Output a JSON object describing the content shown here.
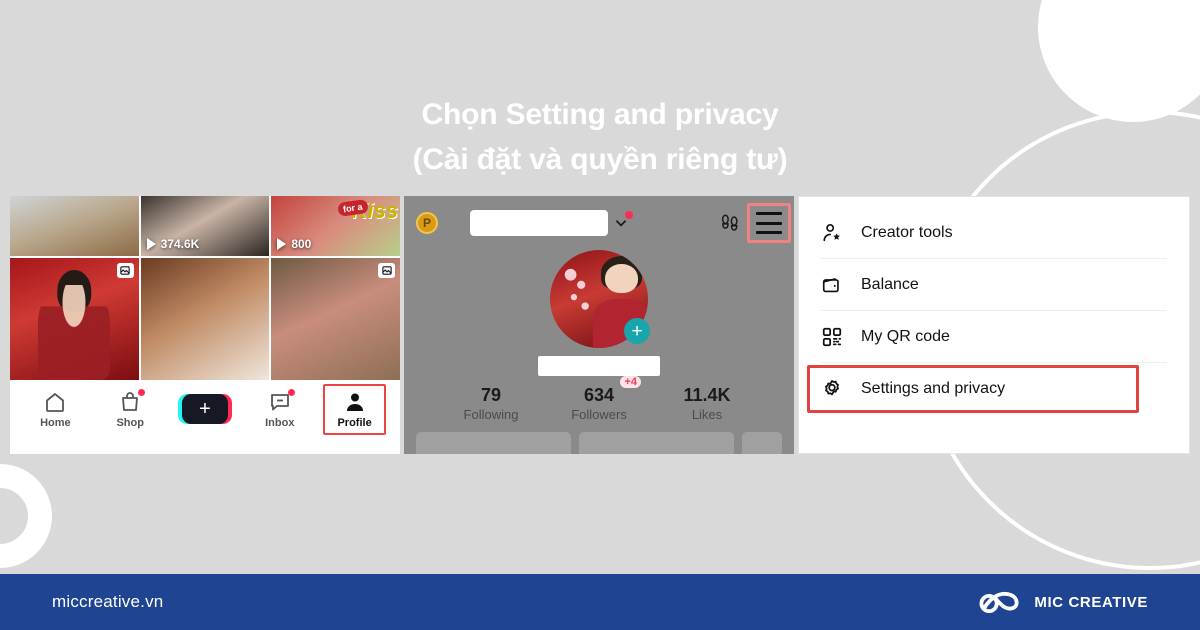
{
  "page": {
    "background_color": "#d9d9d9",
    "headline_line1": "Chọn Setting and privacy",
    "headline_line2": "(Cài đặt và quyền riêng tư)"
  },
  "left_phone": {
    "videos": [
      {
        "id": "v1",
        "views": "",
        "overlay": "none"
      },
      {
        "id": "v2",
        "views": "374.6K",
        "overlay": "play"
      },
      {
        "id": "v3",
        "views": "800",
        "overlay": "play",
        "sticker": "for a",
        "art_text": "Kiss"
      },
      {
        "id": "v4",
        "views": "",
        "overlay": "stack"
      },
      {
        "id": "v5",
        "views": "",
        "overlay": "none"
      },
      {
        "id": "v6",
        "views": "",
        "overlay": "stack"
      }
    ],
    "bottom_nav": [
      {
        "label": "Home",
        "icon": "home-icon",
        "active": false,
        "badge": false
      },
      {
        "label": "Shop",
        "icon": "shop-bag-icon",
        "active": false,
        "badge": true
      },
      {
        "label": "",
        "icon": "create-plus-icon",
        "active": false,
        "badge": false
      },
      {
        "label": "Inbox",
        "icon": "inbox-message-icon",
        "active": false,
        "badge": true
      },
      {
        "label": "Profile",
        "icon": "profile-person-icon",
        "active": true,
        "badge": false
      }
    ]
  },
  "mid_phone": {
    "coin_label": "P",
    "username_redacted": true,
    "handle_redacted": true,
    "header_icons": [
      {
        "name": "chevron-down-icon",
        "badge": true
      },
      {
        "name": "footprints-icon",
        "badge": false
      },
      {
        "name": "hamburger-menu-icon",
        "badge": false,
        "highlighted": true
      }
    ],
    "avatar_add_label": "+",
    "stats": [
      {
        "num": "79",
        "label": "Following",
        "badge": ""
      },
      {
        "num": "634",
        "label": "Followers",
        "badge": "+4"
      },
      {
        "num": "11.4K",
        "label": "Likes",
        "badge": ""
      }
    ]
  },
  "menu": {
    "items": [
      {
        "label": "Creator tools",
        "icon": "person-star-icon",
        "highlighted": false
      },
      {
        "label": "Balance",
        "icon": "wallet-icon",
        "highlighted": false
      },
      {
        "label": "My QR code",
        "icon": "qr-code-icon",
        "highlighted": false
      },
      {
        "label": "Settings and privacy",
        "icon": "gear-icon",
        "highlighted": true
      }
    ]
  },
  "footer": {
    "url": "miccreative.vn",
    "brand": "MIC CREATIVE",
    "bar_color": "#1e4492"
  },
  "colors": {
    "highlight_red": "#e04344",
    "highlight_salmon": "#f0827f",
    "badge_red": "#fe2c55",
    "teal": "#18a5ac",
    "footer_blue": "#1e4492"
  }
}
